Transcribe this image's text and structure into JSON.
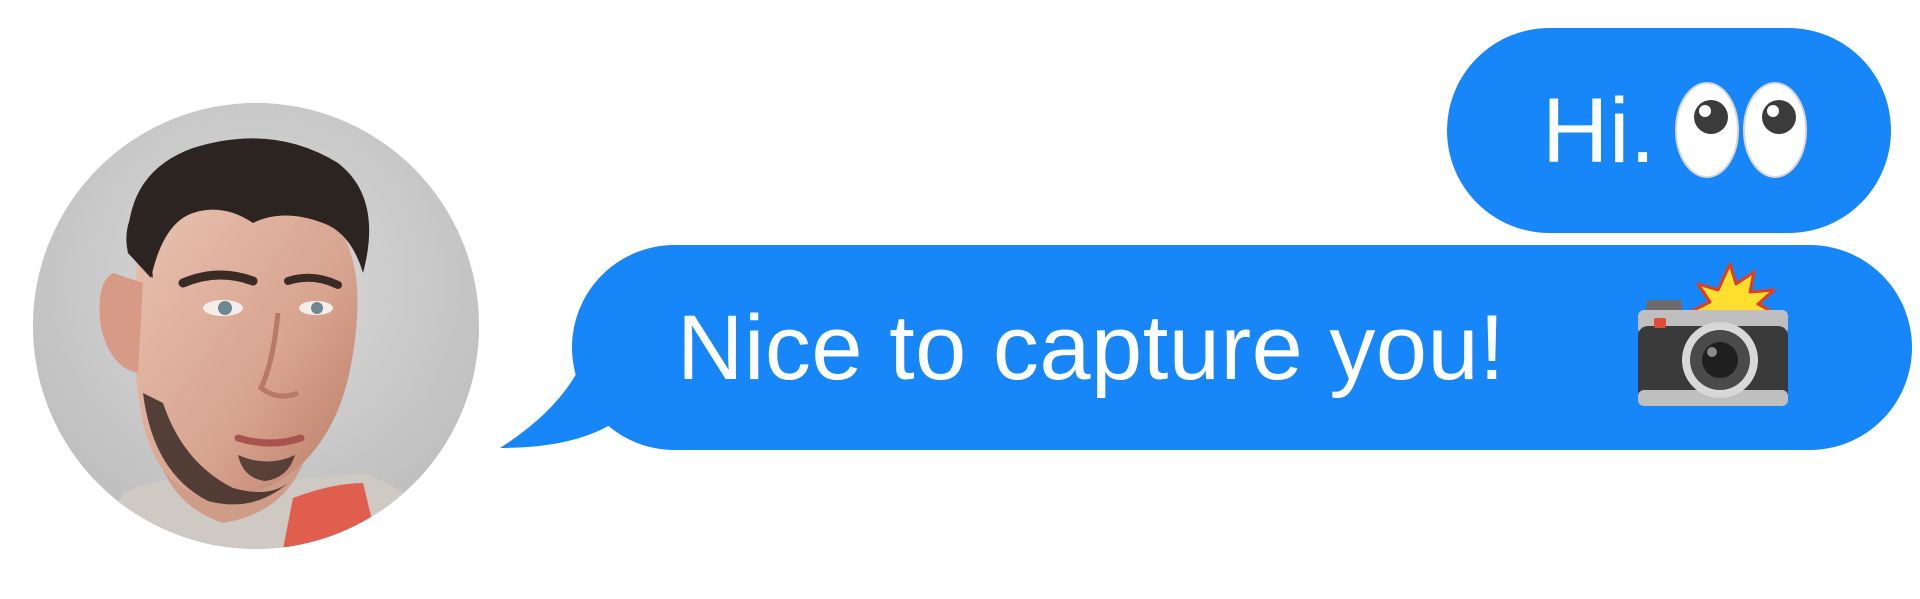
{
  "avatar": {
    "alt": "contact photo"
  },
  "messages": [
    {
      "text": "Hi.",
      "emoji": "eyes-icon",
      "direction": "outgoing"
    },
    {
      "text": "Nice to capture you!",
      "emoji": "camera-with-flash-icon",
      "direction": "outgoing"
    }
  ],
  "colors": {
    "bubble": "#1786f8",
    "bubble_text": "#ffffff",
    "background": "#ffffff"
  }
}
